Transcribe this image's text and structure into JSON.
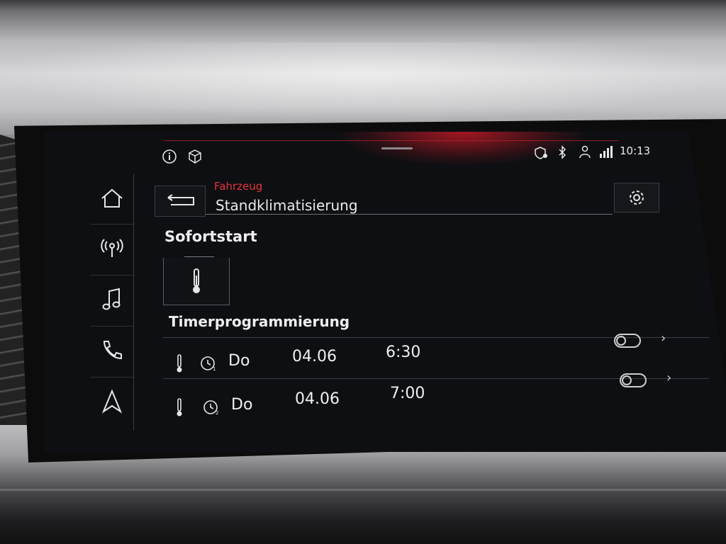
{
  "status_bar": {
    "time": "10:13",
    "icons": [
      "info-icon",
      "cube-icon",
      "shield-location-icon",
      "bluetooth-icon",
      "person-signal-icon",
      "data-signal-icon"
    ]
  },
  "sidebar": {
    "items": [
      {
        "name": "home",
        "icon": "home-icon"
      },
      {
        "name": "radio",
        "icon": "radio-antenna-icon"
      },
      {
        "name": "media",
        "icon": "music-note-icon"
      },
      {
        "name": "phone",
        "icon": "phone-icon"
      },
      {
        "name": "navigation",
        "icon": "navigation-arrow-icon"
      }
    ]
  },
  "header": {
    "breadcrumb": "Fahrzeug",
    "title": "Standklimatisierung",
    "back_icon": "back-arrow-icon",
    "settings_icon": "gear-icon"
  },
  "sofortstart": {
    "title": "Sofortstart",
    "icon": "thermometer-icon"
  },
  "timer": {
    "title": "Timerprogrammierung",
    "rows": [
      {
        "timer_icon": "clock-1-icon",
        "day": "Do",
        "date": "04.06",
        "time": "6:30",
        "toggle": "off"
      },
      {
        "timer_icon": "clock-2-icon",
        "day": "Do",
        "date": "04.06",
        "time": "7:00",
        "toggle": "off"
      }
    ]
  },
  "colors": {
    "accent_red": "#e8323c",
    "screen_bg": "#0d0f12",
    "text": "#f0f0f0"
  }
}
